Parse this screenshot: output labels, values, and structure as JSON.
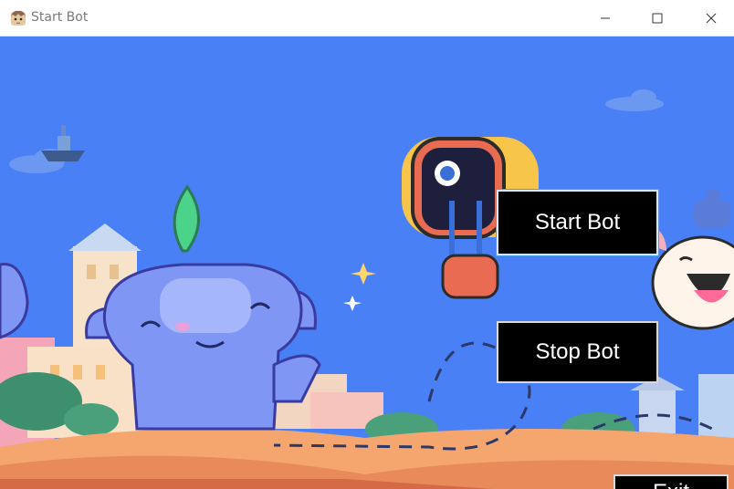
{
  "window": {
    "title": "Start Bot",
    "app_icon": "anime-avatar-icon",
    "controls": [
      "minimize-icon",
      "maximize-icon",
      "close-icon"
    ]
  },
  "buttons": {
    "start_label": "Start Bot",
    "stop_label": "Stop Bot",
    "exit_label": "Exit"
  },
  "colors": {
    "background_sky": "#4a80f5",
    "button_bg": "#000000",
    "button_text": "#ffffff",
    "mascot_blue": "#7f96f4"
  }
}
